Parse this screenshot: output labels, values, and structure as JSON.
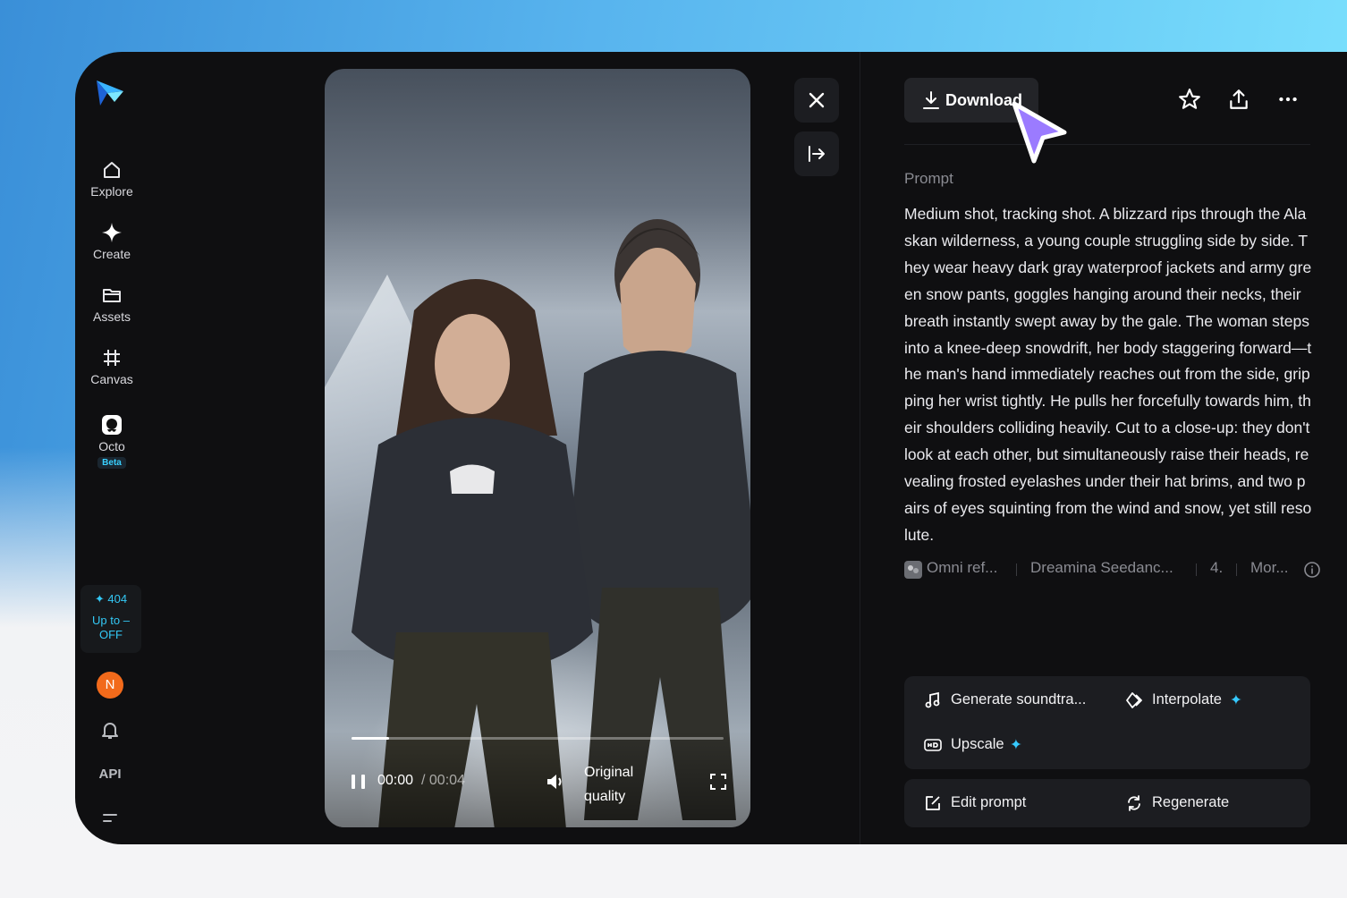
{
  "sidebar": {
    "items": [
      {
        "label": "Explore",
        "icon": "home-icon"
      },
      {
        "label": "Create",
        "icon": "sparkle-icon"
      },
      {
        "label": "Assets",
        "icon": "folder-icon"
      },
      {
        "label": "Canvas",
        "icon": "frame-icon"
      },
      {
        "label": "Octo",
        "icon": "octo-icon",
        "badge": "Beta"
      }
    ],
    "credits": {
      "count": "404",
      "line1": "Up to –",
      "line2": "OFF"
    },
    "avatar_initial": "N",
    "api_label": "API"
  },
  "video": {
    "current_time": "00:00",
    "duration": "/ 00:04",
    "quality_line1": "Original",
    "quality_line2": "quality",
    "progress": 0.1
  },
  "panel": {
    "download_label": "Download",
    "prompt_label": "Prompt",
    "prompt_text": "Medium shot, tracking shot. A blizzard rips through the Alaskan wilderness, a young couple struggling side by side. They wear heavy dark gray waterproof jackets and army green snow pants, goggles hanging around their necks, their breath instantly swept away by the gale. The woman steps into a knee-deep snowdrift, her body staggering forward—the man's hand immediately reaches out from the side, gripping her wrist tightly. He pulls her forcefully towards him, their shoulders colliding heavily. Cut to a close-up: they don't look at each other, but simultaneously raise their heads, revealing frosted eyelashes under their hat brims, and two pairs of eyes squinting from the wind and snow, yet still resolute.",
    "meta": {
      "reference": "Omni ref...",
      "model": "Dreamina Seedanc...",
      "version": "4.",
      "more": "Mor..."
    },
    "actions": {
      "soundtrack": "Generate soundtra...",
      "interpolate": "Interpolate",
      "upscale": "Upscale",
      "edit_prompt": "Edit prompt",
      "regenerate": "Regenerate"
    }
  },
  "colors": {
    "accent": "#36c9ff",
    "avatar": "#f26a1b",
    "background": "#0f0f11"
  }
}
